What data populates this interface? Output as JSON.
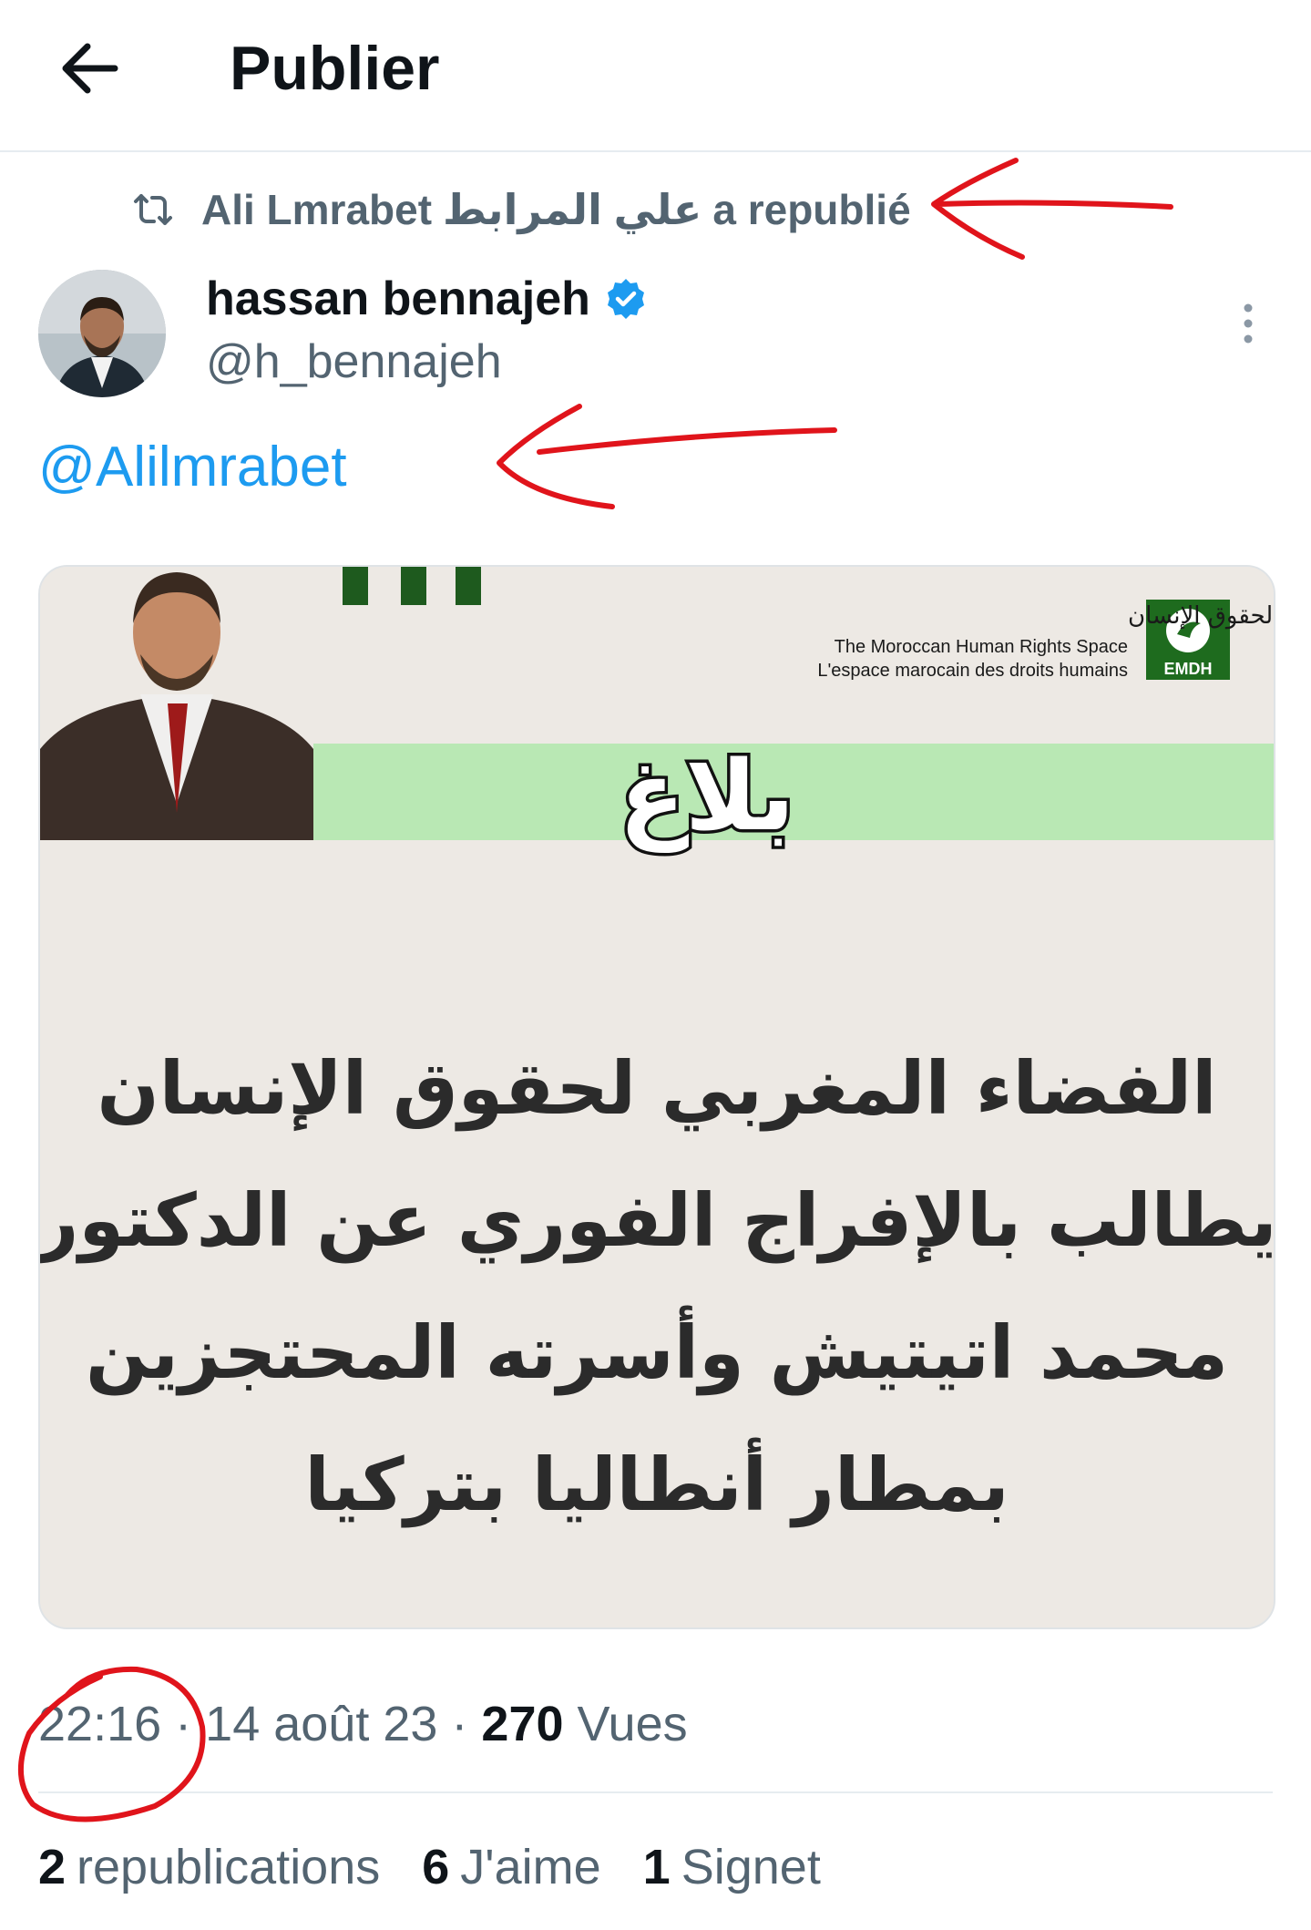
{
  "header": {
    "title": "Publier",
    "back_icon": "arrow-left-icon"
  },
  "repost": {
    "icon": "repost-icon",
    "user": "Ali Lmrabet",
    "user_arabic": "علي المرابط",
    "suffix": "a republié"
  },
  "author": {
    "name": "hassan bennajeh",
    "handle": "@h_bennajeh",
    "verified": true
  },
  "post": {
    "mention": "@Alilmrabet"
  },
  "media": {
    "org_name_ar": "الفضاء المغربي لحقوق الإنسان",
    "org_name_en": "The Moroccan Human Rights Space",
    "org_name_fr": "L'espace marocain des droits humains",
    "org_abbr": "EMDH",
    "headline": "بلاغ",
    "body_lines": [
      "الفضاء المغربي لحقوق الإنسان",
      "يطالب بالإفراج الفوري عن الدكتور",
      "محمد اتيتيش وأسرته المحتجزين",
      "بمطار أنطاليا بتركيا"
    ]
  },
  "meta": {
    "time": "22:16",
    "date": "14 août 23",
    "views_count": "270",
    "views_label": "Vues"
  },
  "stats": {
    "reposts_count": "2",
    "reposts_label": "republications",
    "likes_count": "6",
    "likes_label": "J'aime",
    "bookmarks_count": "1",
    "bookmarks_label": "Signet"
  },
  "colors": {
    "accent": "#1d9bf0",
    "annotation": "#e0141b",
    "banner": "#b9e8b4",
    "card_bg": "#ede9e4"
  }
}
